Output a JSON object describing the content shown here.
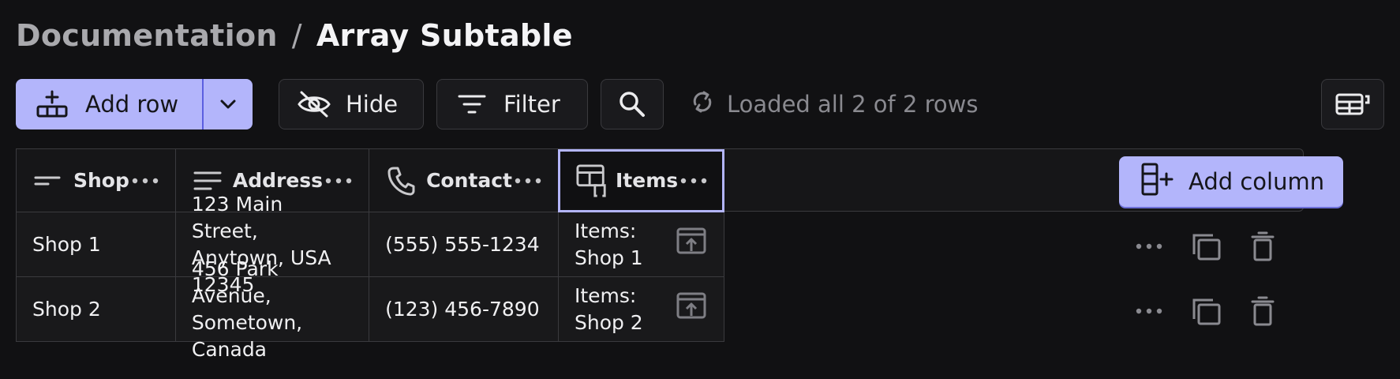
{
  "breadcrumb": {
    "root": "Documentation",
    "separator": "/",
    "current": "Array Subtable"
  },
  "toolbar": {
    "add_row_label": "Add row",
    "hide_label": "Hide",
    "filter_label": "Filter",
    "status_text": "Loaded all 2 of 2 rows"
  },
  "columns": [
    {
      "label": "Shop",
      "icon": "short-text-icon"
    },
    {
      "label": "Address",
      "icon": "long-text-icon"
    },
    {
      "label": "Contact",
      "icon": "phone-icon"
    },
    {
      "label": "Items",
      "icon": "subtable-icon"
    }
  ],
  "add_column_label": "Add column",
  "rows": [
    {
      "shop": "Shop 1",
      "address_line1": "123 Main Street,",
      "address_line2": "Anytown, USA 12345",
      "contact": "(555) 555-1234",
      "items": "Items: Shop 1"
    },
    {
      "shop": "Shop 2",
      "address_line1": "456 Park Avenue,",
      "address_line2": "Sometown, Canada",
      "contact": "(123) 456-7890",
      "items": "Items: Shop 2"
    }
  ],
  "colors": {
    "accent": "#b3b5fb",
    "background": "#111113",
    "border": "#3a3a3e",
    "muted_text": "#8a8a90"
  }
}
